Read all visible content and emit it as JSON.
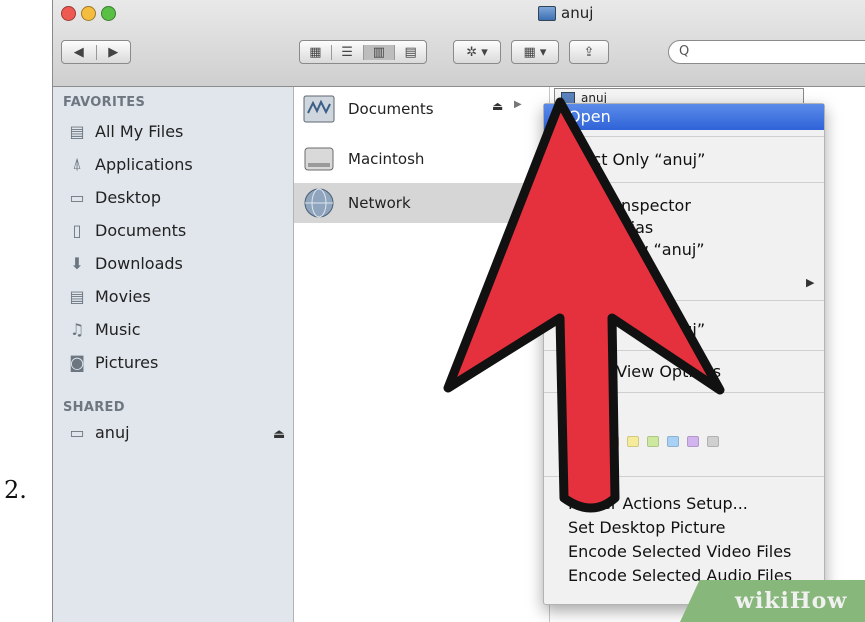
{
  "step_number": "2.",
  "window": {
    "title": "anuj",
    "traffic_lights": [
      "#ee5a52",
      "#f5bd3f",
      "#59c045"
    ]
  },
  "toolbar": {
    "back_icon": "chevron-left-icon",
    "forward_icon": "chevron-right-icon",
    "view_icons": [
      "icon-view-icon",
      "list-view-icon",
      "column-view-icon",
      "coverflow-view-icon"
    ],
    "action_icon": "gear-icon",
    "arrange_icon": "arrange-icon",
    "share_icon": "share-icon",
    "search_placeholder": "Q"
  },
  "sidebar": {
    "favorites_heading": "FAVORITES",
    "favorites": [
      {
        "label": "All My Files",
        "icon": "all-files-icon"
      },
      {
        "label": "Applications",
        "icon": "applications-icon"
      },
      {
        "label": "Desktop",
        "icon": "desktop-icon"
      },
      {
        "label": "Documents",
        "icon": "documents-icon"
      },
      {
        "label": "Downloads",
        "icon": "downloads-icon"
      },
      {
        "label": "Movies",
        "icon": "movies-icon"
      },
      {
        "label": "Music",
        "icon": "music-icon"
      },
      {
        "label": "Pictures",
        "icon": "pictures-icon"
      }
    ],
    "shared_heading": "SHARED",
    "shared": [
      {
        "label": "anuj",
        "icon": "computer-icon"
      }
    ],
    "eject_glyph": "⏏"
  },
  "column1": {
    "items": [
      {
        "label": "Documents",
        "icon": "disk-image-icon"
      },
      {
        "label": "Macintosh",
        "icon": "hard-drive-icon"
      },
      {
        "label": "Network",
        "icon": "network-globe-icon"
      }
    ],
    "eject_glyph": "⏏",
    "arrow_glyph": "▶"
  },
  "column2": {
    "item_label": "anuj"
  },
  "context_menu": {
    "items": [
      {
        "label": "Open",
        "highlighted": true
      },
      {
        "label": "Eject Only “anuj”"
      },
      {
        "label": "Show Inspector"
      },
      {
        "label": "Make Alias"
      },
      {
        "label": "Slideshow “anuj”"
      },
      {
        "label": "“anuj”"
      },
      {
        "label": "Show View Options"
      },
      {
        "label": "Label:"
      },
      {
        "label": "Folder Actions Setup..."
      },
      {
        "label": "Set Desktop Picture"
      },
      {
        "label": "Encode Selected Video Files"
      },
      {
        "label": "Encode Selected Audio Files"
      }
    ],
    "label_clear": "×",
    "label_colors": [
      "#f6a1a6",
      "#f8c49a",
      "#f5ec9b",
      "#cde9a0",
      "#a9d0f5",
      "#d2b4ee",
      "#d0d0d0"
    ]
  },
  "annotation_arrow": {
    "color": "#e5303d",
    "outline": "#111111"
  },
  "watermark": {
    "text": "wikiHow",
    "color": "#87b77a"
  }
}
